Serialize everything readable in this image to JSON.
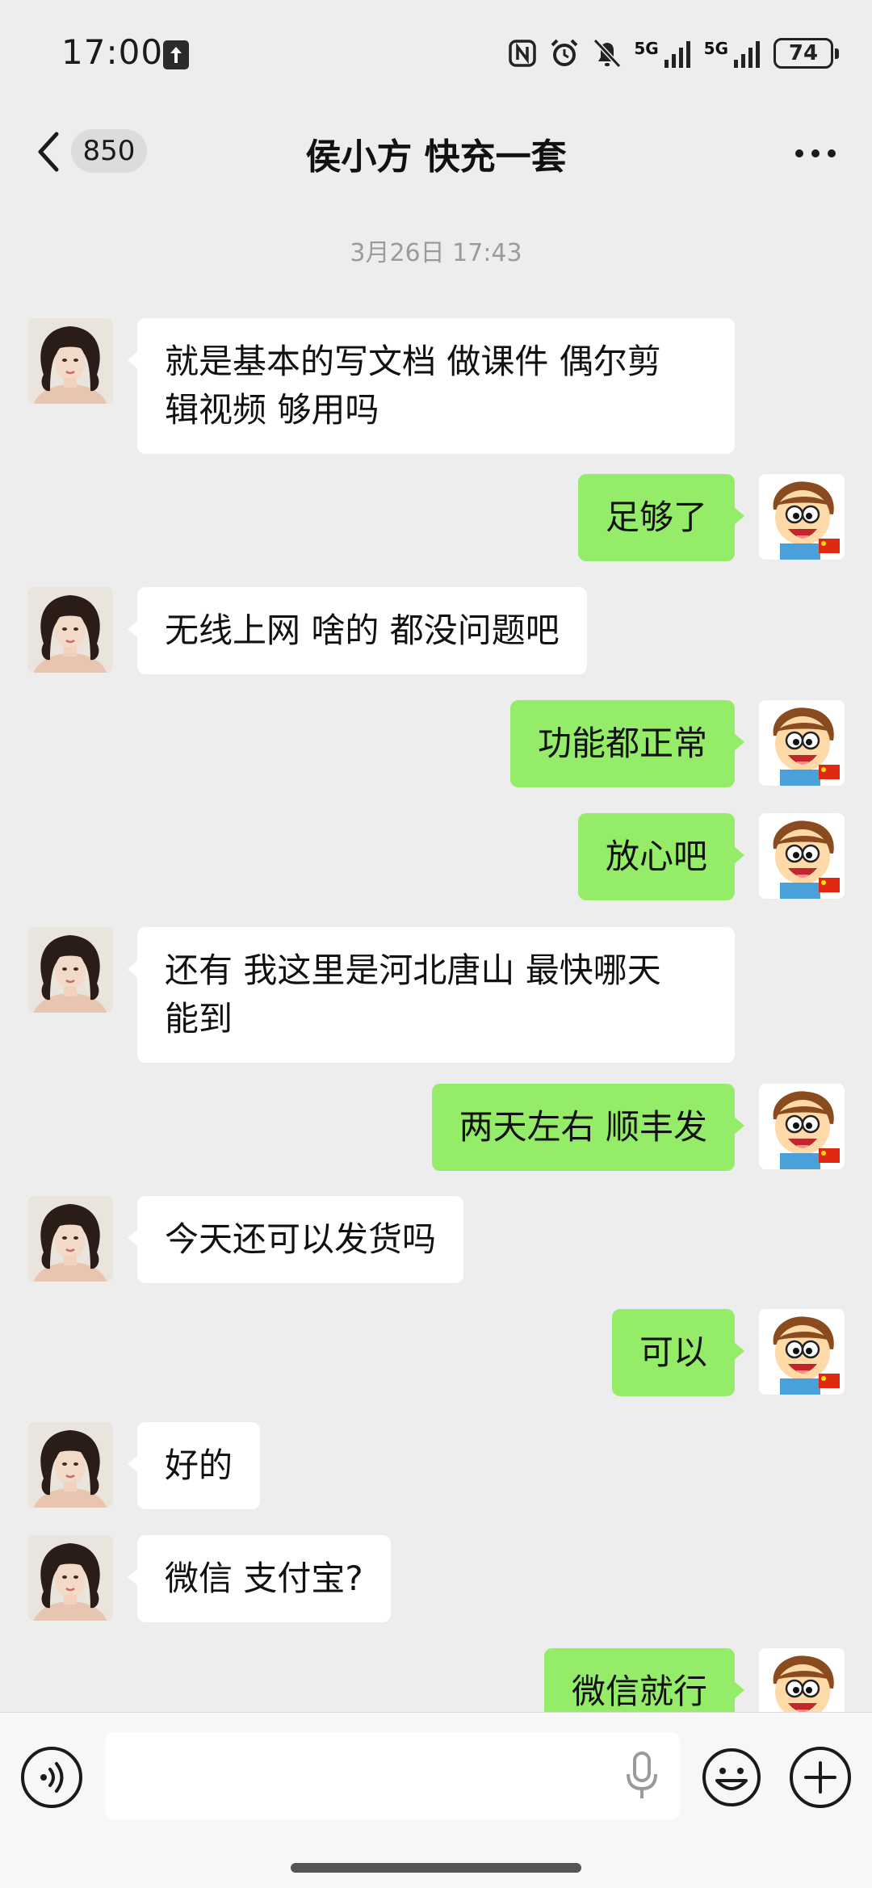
{
  "status_bar": {
    "time": "17:00",
    "network_1": "5G",
    "network_2": "5G",
    "battery": "74"
  },
  "header": {
    "unread_count": "850",
    "title": "侯小方 快充一套"
  },
  "timestamp": "3月26日 17:43",
  "messages": [
    {
      "side": "in",
      "text_lines": [
        "就是基本的写文档 做课件 偶尔剪",
        "辑视频 够用吗"
      ]
    },
    {
      "side": "out",
      "text": "足够了"
    },
    {
      "side": "in",
      "text": "无线上网 啥的 都没问题吧"
    },
    {
      "side": "out",
      "text": "功能都正常"
    },
    {
      "side": "out",
      "text": "放心吧"
    },
    {
      "side": "in",
      "text_lines": [
        "还有 我这里是河北唐山 最快哪天",
        "能到"
      ]
    },
    {
      "side": "out",
      "text": "两天左右 顺丰发"
    },
    {
      "side": "in",
      "text": "今天还可以发货吗"
    },
    {
      "side": "out",
      "text": "可以"
    },
    {
      "side": "in",
      "text": "好的"
    },
    {
      "side": "in",
      "text": "微信 支付宝?"
    },
    {
      "side": "out",
      "text": "微信就行"
    }
  ],
  "input": {
    "placeholder": ""
  },
  "icons": {
    "voice": "voice-icon",
    "mic": "mic-icon",
    "emoji": "emoji-icon",
    "plus": "plus-icon",
    "back": "chevron-left-icon",
    "more": "more-icon"
  },
  "colors": {
    "background": "#ededed",
    "outgoing_bubble": "#95ec69",
    "incoming_bubble": "#ffffff"
  }
}
